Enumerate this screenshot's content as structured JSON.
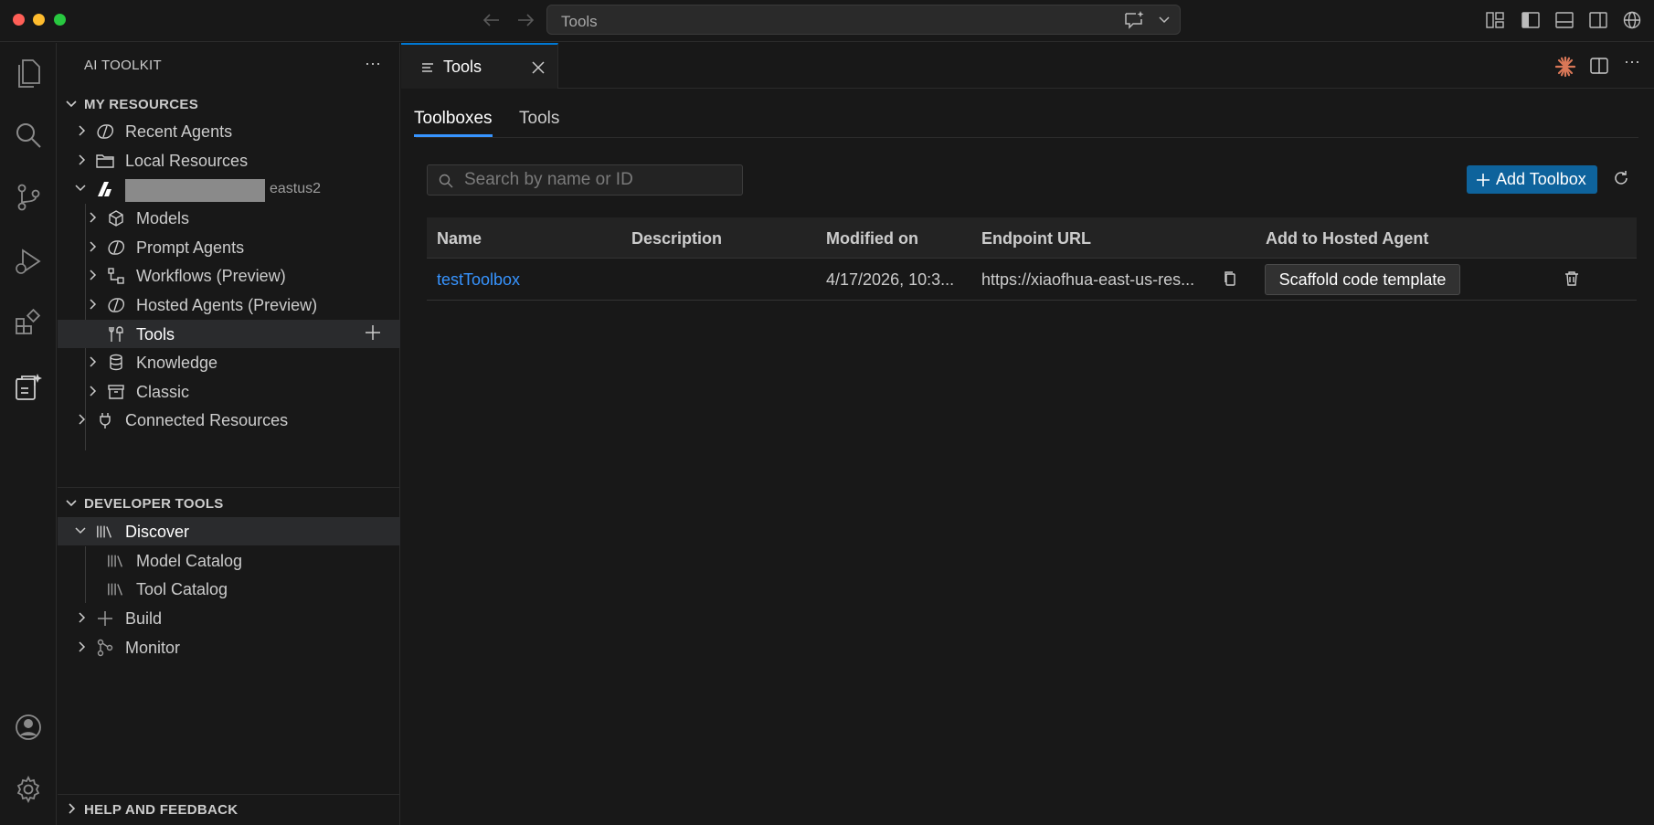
{
  "titlebar": {
    "command_center": "Tools"
  },
  "sidebar": {
    "title": "AI TOOLKIT",
    "my_resources": {
      "header": "MY RESOURCES",
      "recent_agents": "Recent Agents",
      "local_resources": "Local Resources",
      "project_region": "eastus2",
      "models": "Models",
      "prompt_agents": "Prompt Agents",
      "workflows": "Workflows (Preview)",
      "hosted_agents": "Hosted Agents (Preview)",
      "tools": "Tools",
      "knowledge": "Knowledge",
      "classic": "Classic",
      "connected_resources": "Connected Resources"
    },
    "developer_tools": {
      "header": "DEVELOPER TOOLS",
      "discover": "Discover",
      "model_catalog": "Model Catalog",
      "tool_catalog": "Tool Catalog",
      "build": "Build",
      "monitor": "Monitor"
    },
    "help": {
      "header": "HELP AND FEEDBACK"
    }
  },
  "editor": {
    "tab_label": "Tools",
    "subtabs": [
      "Toolboxes",
      "Tools"
    ],
    "search_placeholder": "Search by name or ID",
    "add_button": "Add Toolbox",
    "table": {
      "columns": [
        "Name",
        "Description",
        "Modified on",
        "Endpoint URL",
        "Add to Hosted Agent"
      ],
      "rows": [
        {
          "name": "testToolbox",
          "description": "",
          "modified_on": "4/17/2026, 10:3...",
          "endpoint_url": "https://xiaofhua-east-us-res...",
          "action": "Scaffold code template"
        }
      ]
    }
  },
  "colors": {
    "accent": "#0078d4",
    "button_primary": "#0e639c",
    "link": "#3794ff",
    "background": "#181818",
    "claude_icon": "#d97757"
  }
}
